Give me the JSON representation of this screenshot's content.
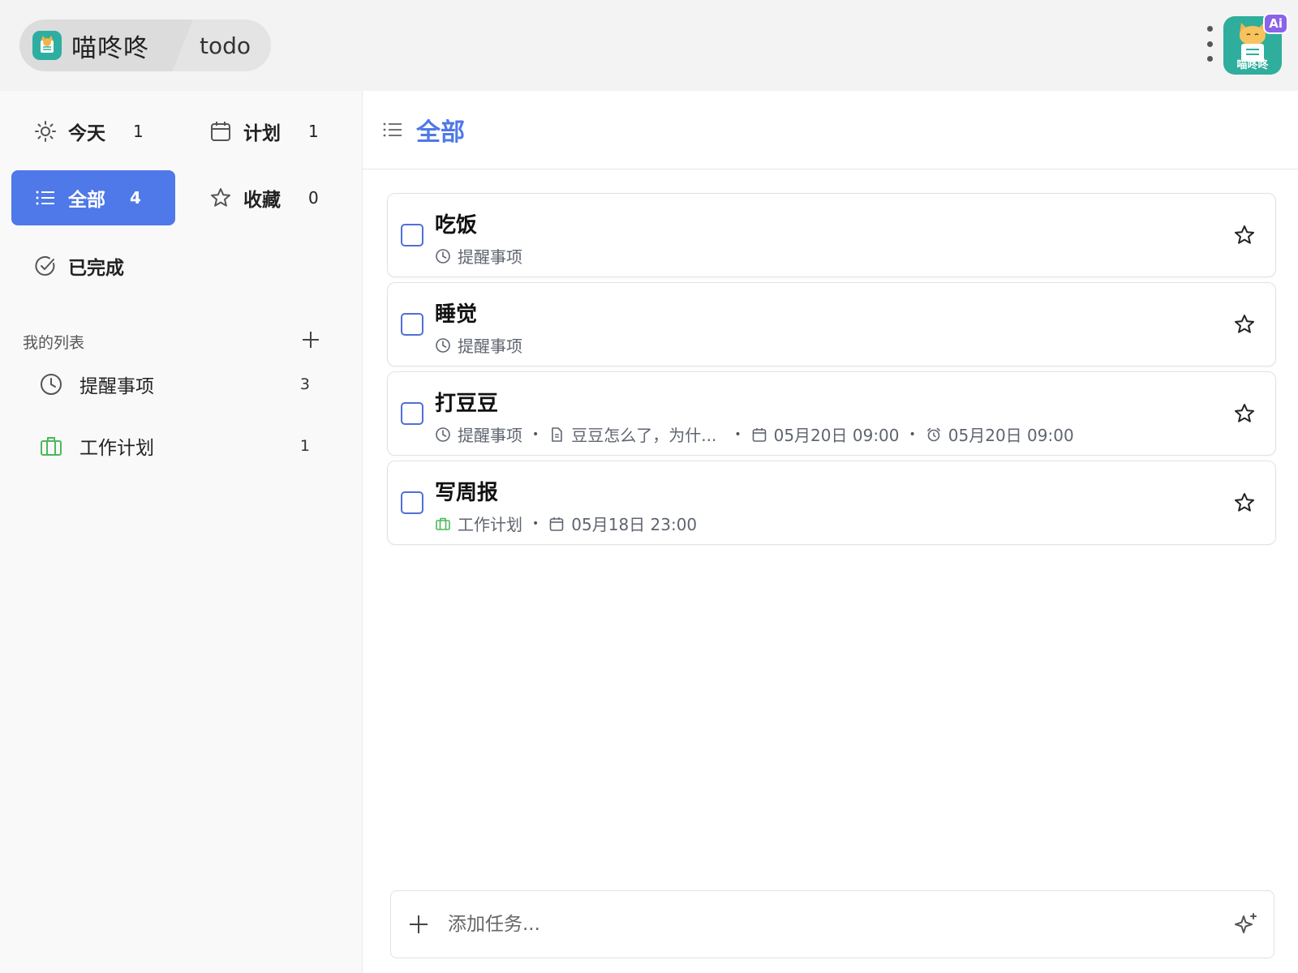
{
  "topbar": {
    "app_name": "喵咚咚",
    "tab_label": "todo",
    "ai_badge": "Ai",
    "ai_label": "喵咚咚"
  },
  "sidebar": {
    "nav": {
      "today": {
        "label": "今天",
        "count": "1"
      },
      "plan": {
        "label": "计划",
        "count": "1"
      },
      "all": {
        "label": "全部",
        "count": "4"
      },
      "starred": {
        "label": "收藏",
        "count": "0"
      },
      "completed": {
        "label": "已完成"
      }
    },
    "my_lists_title": "我的列表",
    "lists": [
      {
        "label": "提醒事项",
        "count": "3",
        "icon": "clock-icon"
      },
      {
        "label": "工作计划",
        "count": "1",
        "icon": "briefcase-icon",
        "icon_color": "#4cb85a"
      }
    ]
  },
  "main": {
    "title": "全部",
    "tasks": [
      {
        "title": "吃饭",
        "list": "提醒事项"
      },
      {
        "title": "睡觉",
        "list": "提醒事项"
      },
      {
        "title": "打豆豆",
        "list": "提醒事项",
        "note": "豆豆怎么了，为什...",
        "due": "05月20日 09:00",
        "reminder": "05月20日 09:00"
      },
      {
        "title": "写周报",
        "list": "工作计划",
        "due": "05月18日 23:00"
      }
    ],
    "add_task_placeholder": "添加任务..."
  },
  "colors": {
    "accent": "#4f78e8",
    "work_list": "#4cb85a",
    "ai_badge": "#8a63e8",
    "app_logo": "#2eaea0"
  }
}
